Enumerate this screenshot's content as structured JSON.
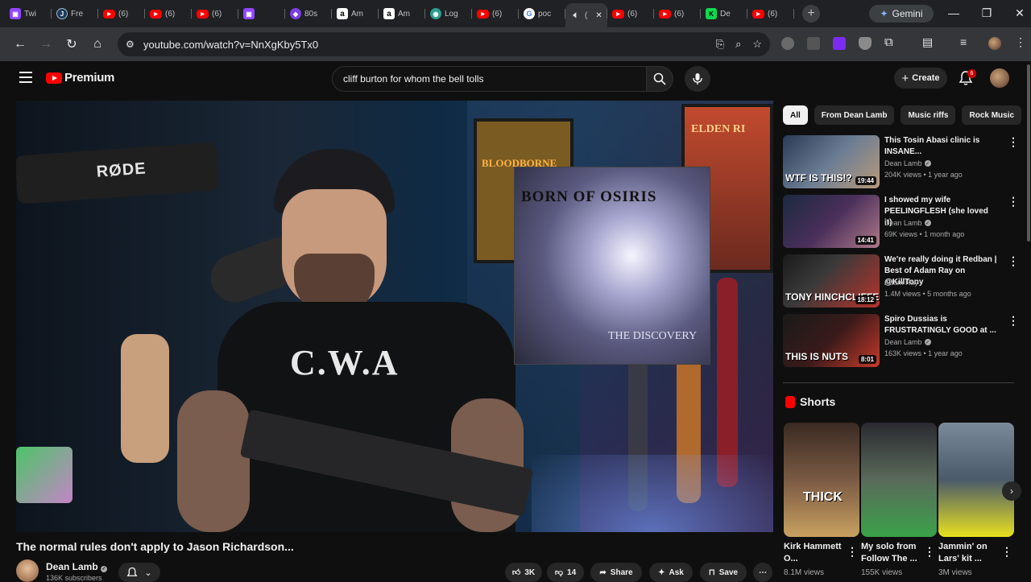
{
  "browser": {
    "tabs": [
      {
        "label": "Twi",
        "icon": "twitch-icon"
      },
      {
        "label": "Fre",
        "icon": "jellyfin-icon"
      },
      {
        "label": "(6)",
        "icon": "youtube-icon"
      },
      {
        "label": "(6)",
        "icon": "youtube-icon"
      },
      {
        "label": "(6)",
        "icon": "youtube-icon"
      },
      {
        "label": "",
        "icon": "twitch-icon"
      },
      {
        "label": "80s",
        "icon": "app-icon"
      },
      {
        "label": "Am",
        "icon": "amazon-icon"
      },
      {
        "label": "Am",
        "icon": "amazon-icon"
      },
      {
        "label": "Log",
        "icon": "login-icon"
      },
      {
        "label": "(6)",
        "icon": "youtube-icon"
      },
      {
        "label": "poc",
        "icon": "google-icon"
      },
      {
        "label": "(",
        "icon": "speaker-icon",
        "active": true
      },
      {
        "label": "(6)",
        "icon": "youtube-icon"
      },
      {
        "label": "(6)",
        "icon": "youtube-icon"
      },
      {
        "label": "De",
        "icon": "kick-icon"
      },
      {
        "label": "(6)",
        "icon": "youtube-icon"
      }
    ],
    "gemini_label": "Gemini",
    "url": "youtube.com/watch?v=NnXgKby5Tx0"
  },
  "header": {
    "logo_text": "Premium",
    "search_value": "cliff burton for whom the bell tolls",
    "create_label": "Create",
    "notif_count": "6"
  },
  "video": {
    "title": "The normal rules don't apply to Jason Richardson...",
    "overlay_album": "BORN OF OSIRIS",
    "overlay_album_sub": "THE DISCOVERY",
    "mic_brand": "RØDE",
    "shirt_text": "C.W.A",
    "poster_text": "BLOODBORNE",
    "poster2_text": "ELDEN RI",
    "channel": "Dean Lamb",
    "subscribers": "136K subscribers",
    "likes": "3K",
    "dislikes": "14",
    "share_label": "Share",
    "ask_label": "Ask",
    "save_label": "Save"
  },
  "sidebar": {
    "chips": [
      "All",
      "From Dean Lamb",
      "Music riffs",
      "Rock Music"
    ],
    "recommendations": [
      {
        "title": "This Tosin Abasi clinic is INSANE...",
        "channel": "Dean Lamb",
        "verified": true,
        "meta": "204K views • 1 year ago",
        "duration": "19:44",
        "thumb_text": "WTF IS THIS!?"
      },
      {
        "title": "I showed my wife PEELINGFLESH (she loved it)",
        "channel": "Dean Lamb",
        "verified": true,
        "meta": "69K views • 1 month ago",
        "duration": "14:41",
        "thumb_text": ""
      },
      {
        "title": "We're really doing it Redban | Best of Adam Ray on @KillTony",
        "channel": "Adam Ray",
        "verified": false,
        "meta": "1.4M views • 5 months ago",
        "duration": "18:12",
        "thumb_text": "TONY HINCHCLIFFE"
      },
      {
        "title": "Spiro Dussias is FRUSTRATINGLY GOOD at ...",
        "channel": "Dean Lamb",
        "verified": true,
        "meta": "163K views • 1 year ago",
        "duration": "8:01",
        "thumb_text": "THIS IS NUTS"
      }
    ],
    "shorts_label": "Shorts",
    "shorts": [
      {
        "title": "Kirk Hammett O...",
        "views": "8.1M views",
        "thumb_text": "THICK"
      },
      {
        "title": "My solo from Follow The ...",
        "views": "155K views",
        "thumb_text": ""
      },
      {
        "title": "Jammin' on Lars' kit ...",
        "views": "3M views",
        "thumb_text": ""
      }
    ]
  }
}
